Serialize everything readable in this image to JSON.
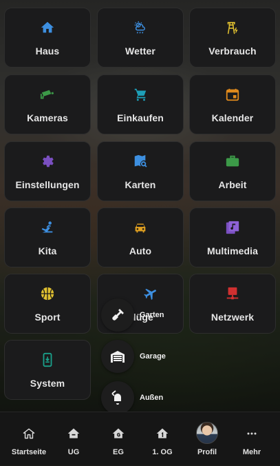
{
  "tiles": [
    {
      "name": "haus",
      "label": "Haus",
      "icon": "home-icon",
      "color": "#3d8fe0"
    },
    {
      "name": "wetter",
      "label": "Wetter",
      "icon": "weather-icon",
      "color": "#3d8fe0"
    },
    {
      "name": "verbrauch",
      "label": "Verbrauch",
      "icon": "power-line-icon",
      "color": "#e0c030"
    },
    {
      "name": "kameras",
      "label": "Kameras",
      "icon": "camera-icon",
      "color": "#3c9a48"
    },
    {
      "name": "einkaufen",
      "label": "Einkaufen",
      "icon": "cart-icon",
      "color": "#1ea0b8"
    },
    {
      "name": "kalender",
      "label": "Kalender",
      "icon": "calendar-icon",
      "color": "#e08a1c"
    },
    {
      "name": "einstellungen",
      "label": "Einstellungen",
      "icon": "gear-icon",
      "color": "#7a4fc0"
    },
    {
      "name": "karten",
      "label": "Karten",
      "icon": "map-search-icon",
      "color": "#3d8fe0"
    },
    {
      "name": "arbeit",
      "label": "Arbeit",
      "icon": "briefcase-icon",
      "color": "#3c9a48"
    },
    {
      "name": "kita",
      "label": "Kita",
      "icon": "child-icon",
      "color": "#3d8fe0"
    },
    {
      "name": "auto",
      "label": "Auto",
      "icon": "car-icon",
      "color": "#e0a020"
    },
    {
      "name": "multimedia",
      "label": "Multimedia",
      "icon": "multimedia-icon",
      "color": "#7a4fc0"
    },
    {
      "name": "sport",
      "label": "Sport",
      "icon": "basketball-icon",
      "color": "#e0c030"
    },
    {
      "name": "fluege",
      "label": "Flüge",
      "icon": "airplane-icon",
      "color": "#3d8fe0"
    },
    {
      "name": "netzwerk",
      "label": "Netzwerk",
      "icon": "network-icon",
      "color": "#d03030"
    },
    {
      "name": "system",
      "label": "System",
      "icon": "tablet-icon",
      "color": "#1aa08a"
    }
  ],
  "popup": [
    {
      "name": "garten",
      "label": "Garten",
      "icon": "shovel-icon"
    },
    {
      "name": "garage",
      "label": "Garage",
      "icon": "garage-icon"
    },
    {
      "name": "aussen",
      "label": "Außen",
      "icon": "door-bell-icon"
    }
  ],
  "nav": [
    {
      "name": "startseite",
      "label": "Startseite",
      "icon": "home-outline-icon"
    },
    {
      "name": "ug",
      "label": "UG",
      "icon": "home-floor-minus-icon"
    },
    {
      "name": "eg",
      "label": "EG",
      "icon": "home-floor-g-icon"
    },
    {
      "name": "og1",
      "label": "1. OG",
      "icon": "home-floor-1-icon"
    },
    {
      "name": "profil",
      "label": "Profil",
      "icon": "avatar"
    },
    {
      "name": "mehr",
      "label": "Mehr",
      "icon": "dots-horizontal-icon"
    }
  ]
}
